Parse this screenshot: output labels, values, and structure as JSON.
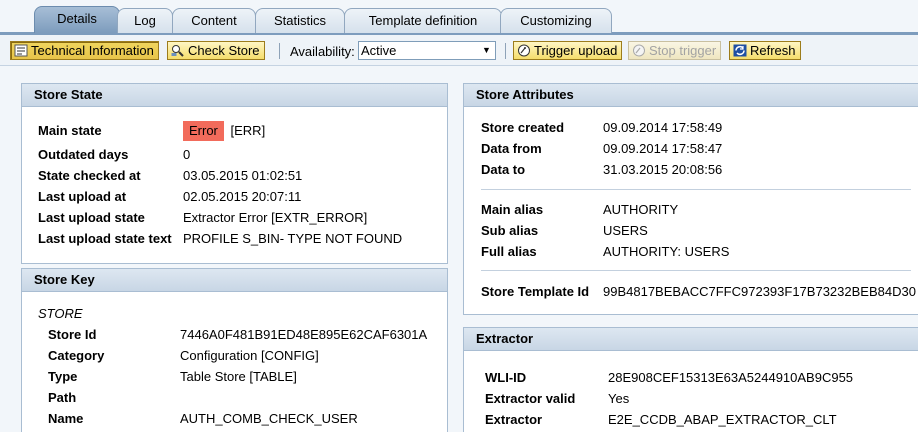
{
  "tabs": [
    {
      "label": "Details",
      "active": true
    },
    {
      "label": "Log"
    },
    {
      "label": "Content"
    },
    {
      "label": "Statistics"
    },
    {
      "label": "Template definition"
    },
    {
      "label": "Customizing"
    }
  ],
  "toolbar": {
    "technical_info": "Technical Information",
    "check_store": "Check Store",
    "availability_label": "Availability:",
    "availability_value": "Active",
    "trigger_upload": "Trigger upload",
    "stop_trigger": "Stop trigger",
    "refresh": "Refresh"
  },
  "store_state": {
    "title": "Store State",
    "rows": [
      {
        "key": "Main state",
        "badge": "Error",
        "value": "[ERR]"
      },
      {
        "key": "Outdated days",
        "value": "0"
      },
      {
        "key": "State checked at",
        "value": "03.05.2015 01:02:51"
      },
      {
        "key": "Last upload at",
        "value": "02.05.2015 20:07:11"
      },
      {
        "key": "Last upload state",
        "value": "Extractor Error [EXTR_ERROR]"
      },
      {
        "key": "Last upload state text",
        "value": "PROFILE S_BIN- TYPE NOT FOUND"
      }
    ],
    "error_color": "#f26b5b"
  },
  "store_key": {
    "title": "Store Key",
    "section": "STORE",
    "rows": [
      {
        "key": "Store Id",
        "value": "7446A0F481B91ED48E895E62CAF6301A"
      },
      {
        "key": "Category",
        "value": "Configuration [CONFIG]"
      },
      {
        "key": "Type",
        "value": "Table Store [TABLE]"
      },
      {
        "key": "Path",
        "value": ""
      },
      {
        "key": "Name",
        "value": "AUTH_COMB_CHECK_USER"
      }
    ]
  },
  "store_attributes": {
    "title": "Store Attributes",
    "rows": [
      {
        "key": "Store created",
        "value": "09.09.2014 17:58:49"
      },
      {
        "key": "Data from",
        "value": "09.09.2014 17:58:47"
      },
      {
        "key": "Data to",
        "value": "31.03.2015 20:08:56"
      },
      {
        "key": "Main alias",
        "value": "AUTHORITY"
      },
      {
        "key": "Sub alias",
        "value": "USERS"
      },
      {
        "key": "Full alias",
        "value": "AUTHORITY: USERS"
      },
      {
        "key": "Store Template Id",
        "value": "99B4817BEBACC7FFC972393F17B73232BEB84D30"
      }
    ]
  },
  "extractor": {
    "title": "Extractor",
    "rows": [
      {
        "key": "WLI-ID",
        "value": "28E908CEF15313E63A5244910AB9C955"
      },
      {
        "key": "Extractor valid",
        "value": "Yes"
      },
      {
        "key": "Extractor",
        "value": "E2E_CCDB_ABAP_EXTRACTOR_CLT"
      }
    ]
  }
}
